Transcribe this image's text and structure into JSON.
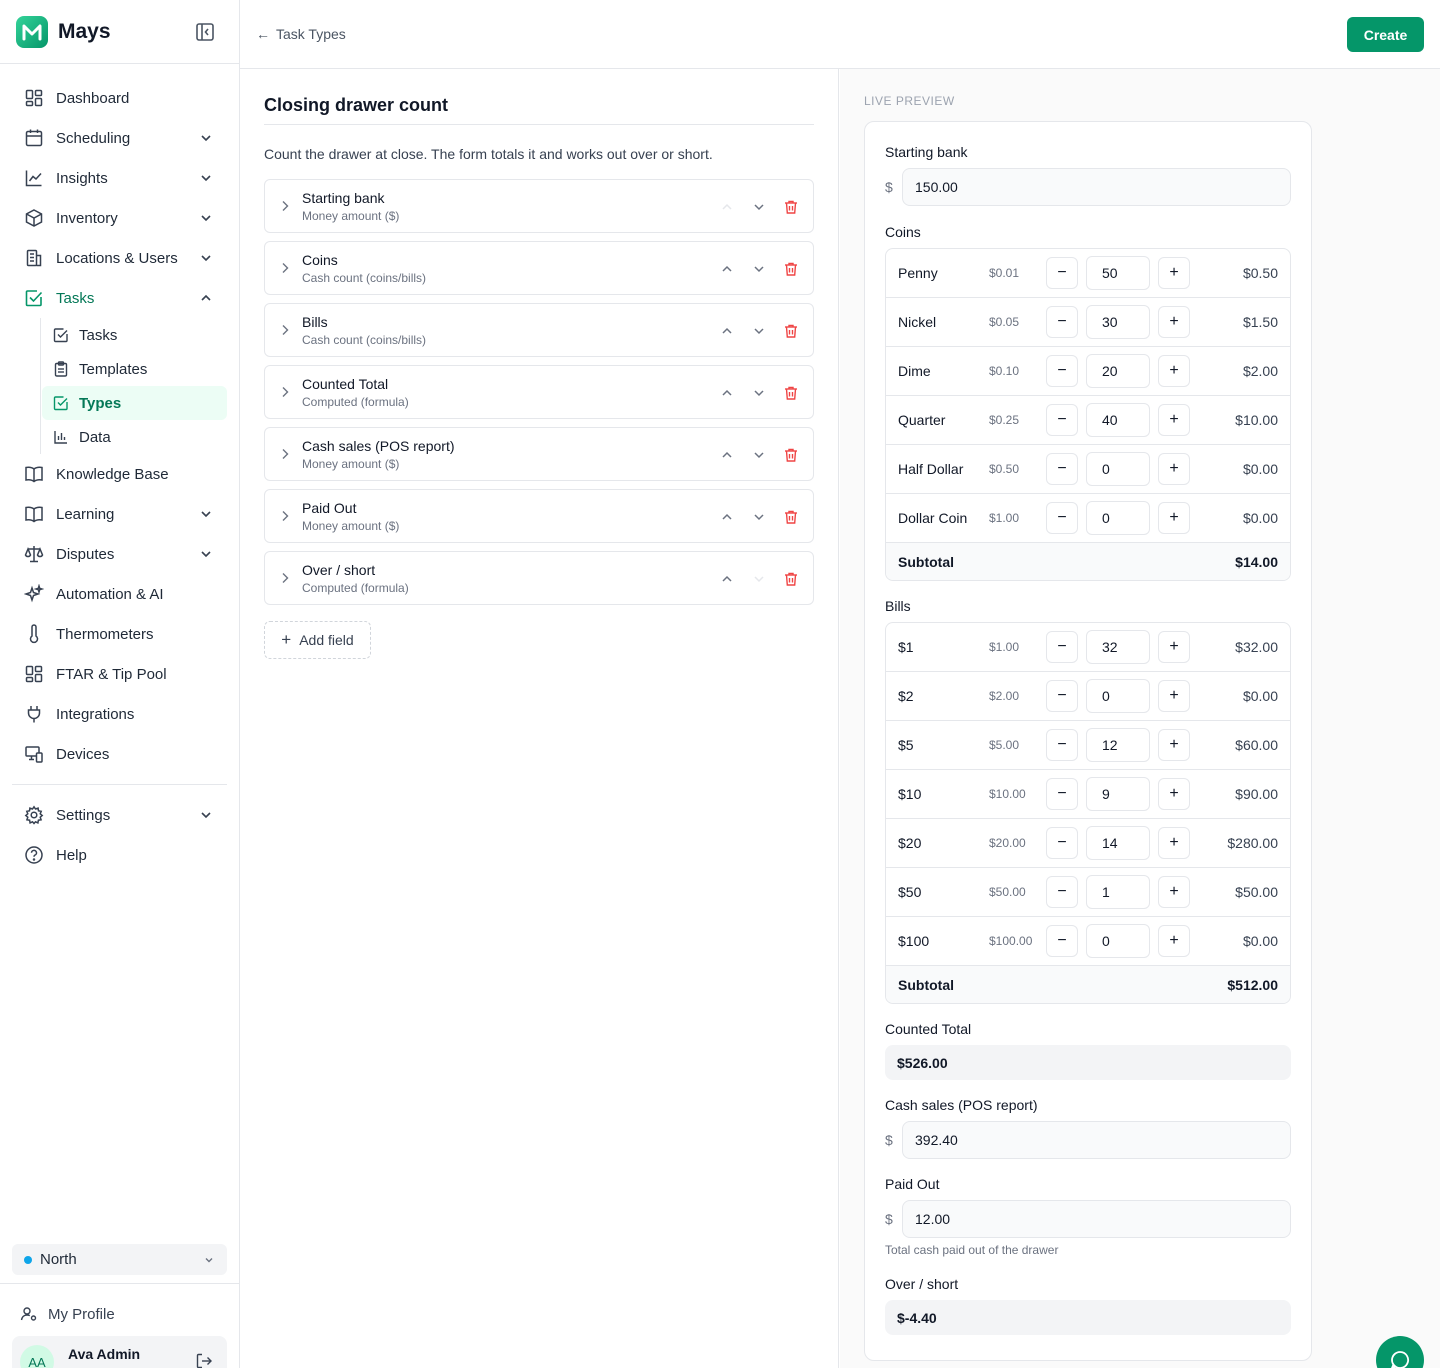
{
  "brand": {
    "name": "Mays"
  },
  "nav": {
    "dashboard": "Dashboard",
    "scheduling": "Scheduling",
    "insights": "Insights",
    "inventory": "Inventory",
    "locations_users": "Locations & Users",
    "tasks": "Tasks",
    "tasks_sub": {
      "tasks": "Tasks",
      "templates": "Templates",
      "types": "Types",
      "data": "Data"
    },
    "knowledge_base": "Knowledge Base",
    "learning": "Learning",
    "disputes": "Disputes",
    "automation": "Automation & AI",
    "thermometers": "Thermometers",
    "ftar": "FTAR & Tip Pool",
    "integrations": "Integrations",
    "devices": "Devices",
    "settings": "Settings",
    "help": "Help"
  },
  "location": {
    "name": "North",
    "dot_color": "#0ea5e9"
  },
  "profile": {
    "my_profile": "My Profile",
    "initials": "AA",
    "user_name": "Ava Admin"
  },
  "topbar": {
    "back_label": "Task Types",
    "back_arrow": "←",
    "create_label": "Create"
  },
  "editor": {
    "title": "Closing drawer count",
    "description": "Count the drawer at close. The form totals it and works out over or short.",
    "fields": [
      {
        "name": "Starting bank",
        "type": "Money amount ($)"
      },
      {
        "name": "Coins",
        "type": "Cash count (coins/bills)"
      },
      {
        "name": "Bills",
        "type": "Cash count (coins/bills)"
      },
      {
        "name": "Counted Total",
        "type": "Computed (formula)"
      },
      {
        "name": "Cash sales (POS report)",
        "type": "Money amount ($)"
      },
      {
        "name": "Paid Out",
        "type": "Money amount ($)"
      },
      {
        "name": "Over / short",
        "type": "Computed (formula)"
      }
    ],
    "add_field_label": "Add field"
  },
  "preview": {
    "label": "LIVE PREVIEW",
    "currency": "$",
    "starting_bank": {
      "label": "Starting bank",
      "value": "150.00"
    },
    "coins": {
      "label": "Coins",
      "rows": [
        {
          "name": "Penny",
          "unit": "$0.01",
          "qty": "50",
          "total": "$0.50"
        },
        {
          "name": "Nickel",
          "unit": "$0.05",
          "qty": "30",
          "total": "$1.50"
        },
        {
          "name": "Dime",
          "unit": "$0.10",
          "qty": "20",
          "total": "$2.00"
        },
        {
          "name": "Quarter",
          "unit": "$0.25",
          "qty": "40",
          "total": "$10.00"
        },
        {
          "name": "Half Dollar",
          "unit": "$0.50",
          "qty": "0",
          "total": "$0.00"
        },
        {
          "name": "Dollar Coin",
          "unit": "$1.00",
          "qty": "0",
          "total": "$0.00"
        }
      ],
      "subtotal_label": "Subtotal",
      "subtotal": "$14.00"
    },
    "bills": {
      "label": "Bills",
      "rows": [
        {
          "name": "$1",
          "unit": "$1.00",
          "qty": "32",
          "total": "$32.00"
        },
        {
          "name": "$2",
          "unit": "$2.00",
          "qty": "0",
          "total": "$0.00"
        },
        {
          "name": "$5",
          "unit": "$5.00",
          "qty": "12",
          "total": "$60.00"
        },
        {
          "name": "$10",
          "unit": "$10.00",
          "qty": "9",
          "total": "$90.00"
        },
        {
          "name": "$20",
          "unit": "$20.00",
          "qty": "14",
          "total": "$280.00"
        },
        {
          "name": "$50",
          "unit": "$50.00",
          "qty": "1",
          "total": "$50.00"
        },
        {
          "name": "$100",
          "unit": "$100.00",
          "qty": "0",
          "total": "$0.00"
        }
      ],
      "subtotal_label": "Subtotal",
      "subtotal": "$512.00"
    },
    "counted_total": {
      "label": "Counted Total",
      "value": "$526.00"
    },
    "cash_sales": {
      "label": "Cash sales (POS report)",
      "value": "392.40"
    },
    "paid_out": {
      "label": "Paid Out",
      "value": "12.00",
      "help": "Total cash paid out of the drawer"
    },
    "over_short": {
      "label": "Over / short",
      "value": "$-4.40"
    }
  },
  "colors": {
    "accent": "#059669",
    "delete": "#ef4444"
  }
}
